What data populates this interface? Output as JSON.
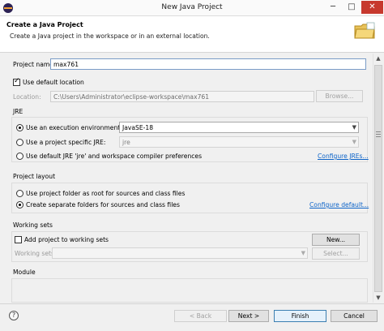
{
  "window": {
    "title": "New Java Project",
    "minimize_glyph": "─",
    "maximize_glyph": "□",
    "close_glyph": "✕"
  },
  "banner": {
    "title": "Create a Java Project",
    "description": "Create a Java project in the workspace or in an external location.",
    "icon": "folder-icon"
  },
  "project": {
    "name_label": "Project name:",
    "name_value": "max761",
    "use_default_location_label": "Use default location",
    "use_default_location_checked": true,
    "location_label": "Location:",
    "location_value": "C:\\Users\\Administrator\\eclipse-workspace\\max761",
    "browse_label": "Browse..."
  },
  "jre": {
    "section_label": "JRE",
    "option_env_label": "Use an execution environment JRE:",
    "option_env_value": "JavaSE-18",
    "option_specific_label": "Use a project specific JRE:",
    "option_specific_value": "jre",
    "option_default_label": "Use default JRE 'jre' and workspace compiler preferences",
    "configure_link": "Configure JREs...",
    "selected": "env"
  },
  "layout": {
    "section_label": "Project layout",
    "option_root_label": "Use project folder as root for sources and class files",
    "option_separate_label": "Create separate folders for sources and class files",
    "configure_link": "Configure default...",
    "selected": "separate"
  },
  "working_sets": {
    "section_label": "Working sets",
    "add_label": "Add project to working sets",
    "add_checked": false,
    "new_button": "New...",
    "sets_label": "Working sets:",
    "sets_value": "",
    "select_button": "Select..."
  },
  "module": {
    "section_label": "Module"
  },
  "footer": {
    "help_glyph": "?",
    "back_button": "< Back",
    "next_button": "Next >",
    "finish_button": "Finish",
    "cancel_button": "Cancel"
  },
  "colors": {
    "link": "#0c63c8",
    "close_button": "#c7392e",
    "focus_border": "#3c7fb1"
  }
}
